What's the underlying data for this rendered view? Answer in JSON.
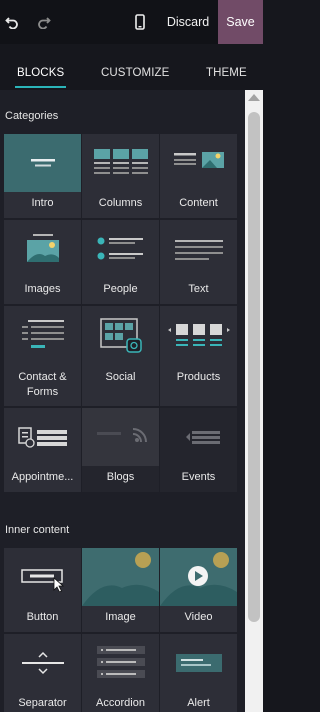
{
  "toolbar": {
    "undo_icon": "undo-icon",
    "redo_icon": "redo-icon",
    "mobile_icon": "mobile-preview-icon",
    "discard_label": "Discard",
    "save_label": "Save",
    "accent_color": "#714b67"
  },
  "tabs": [
    {
      "label": "BLOCKS",
      "active": true
    },
    {
      "label": "CUSTOMIZE",
      "active": false
    },
    {
      "label": "THEME",
      "active": false
    }
  ],
  "tab_indicator_color": "#2bb5b9",
  "sections": {
    "categories": {
      "title": "Categories",
      "items": [
        {
          "label": "Intro"
        },
        {
          "label": "Columns"
        },
        {
          "label": "Content"
        },
        {
          "label": "Images"
        },
        {
          "label": "People"
        },
        {
          "label": "Text"
        },
        {
          "label": "Contact & Forms"
        },
        {
          "label": "Social"
        },
        {
          "label": "Products"
        },
        {
          "label": "Appointme..."
        },
        {
          "label": "Blogs"
        },
        {
          "label": "Events"
        }
      ]
    },
    "inner_content": {
      "title": "Inner content",
      "items": [
        {
          "label": "Button"
        },
        {
          "label": "Image"
        },
        {
          "label": "Video"
        },
        {
          "label": "Separator"
        },
        {
          "label": "Accordion"
        },
        {
          "label": "Alert"
        }
      ]
    }
  }
}
